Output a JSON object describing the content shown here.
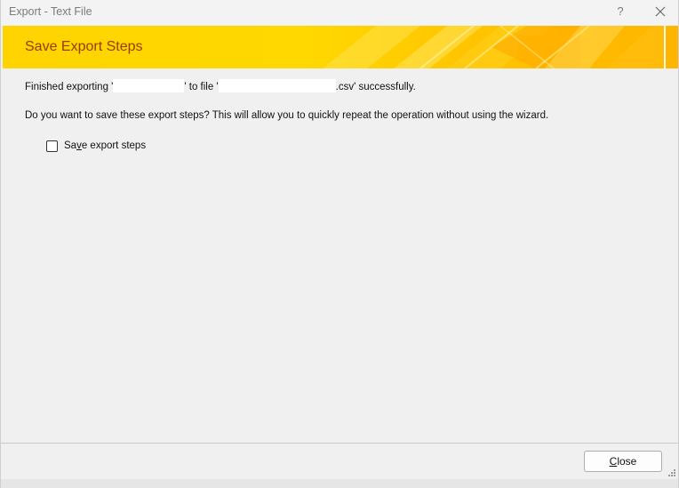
{
  "window": {
    "title": "Export - Text File",
    "help_label": "?"
  },
  "banner": {
    "heading": "Save Export Steps"
  },
  "message": {
    "prefix": "Finished exporting '",
    "middle": "' to file '",
    "suffix": ".csv' successfully.",
    "question": "Do you want to save these export steps? This will allow you to quickly repeat the operation without using the wizard."
  },
  "options": {
    "save_steps_label_pre": "Sa",
    "save_steps_label_accel": "v",
    "save_steps_label_post": "e export steps",
    "save_steps_checked": false
  },
  "footer": {
    "close_label_accel": "C",
    "close_label_rest": "lose"
  },
  "colors": {
    "banner_heading": "#9a3b00",
    "banner_yellow": "#ffd400",
    "banner_orange": "#ffb400"
  },
  "icons": {
    "help": "question-mark",
    "close": "x-close",
    "grip": "resize-grip"
  }
}
